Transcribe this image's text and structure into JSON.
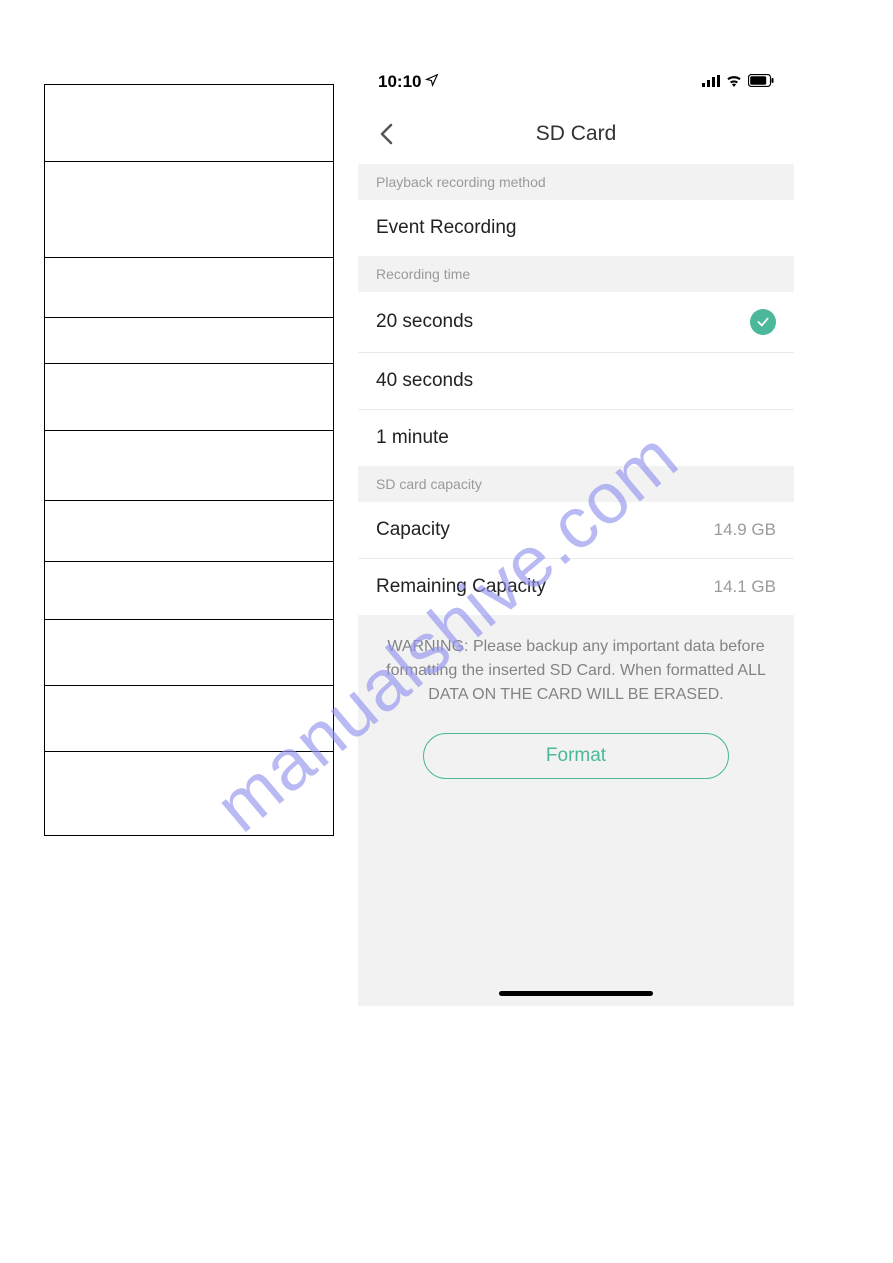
{
  "status_bar": {
    "time": "10:10"
  },
  "header": {
    "title": "SD Card"
  },
  "sections": {
    "playback": {
      "header": "Playback recording method",
      "value": "Event Recording"
    },
    "recording_time": {
      "header": "Recording time",
      "options": [
        {
          "label": "20 seconds",
          "selected": true
        },
        {
          "label": "40 seconds",
          "selected": false
        },
        {
          "label": "1 minute",
          "selected": false
        }
      ]
    },
    "capacity": {
      "header": "SD card capacity",
      "rows": [
        {
          "label": "Capacity",
          "value": "14.9 GB"
        },
        {
          "label": "Remaining Capacity",
          "value": "14.1 GB"
        }
      ]
    }
  },
  "warning": {
    "text": "WARNING: Please backup any important data before formatting the inserted SD Card. When formatted ALL DATA ON THE CARD WILL BE ERASED.",
    "button": "Format"
  },
  "watermark": "manualshive.com"
}
